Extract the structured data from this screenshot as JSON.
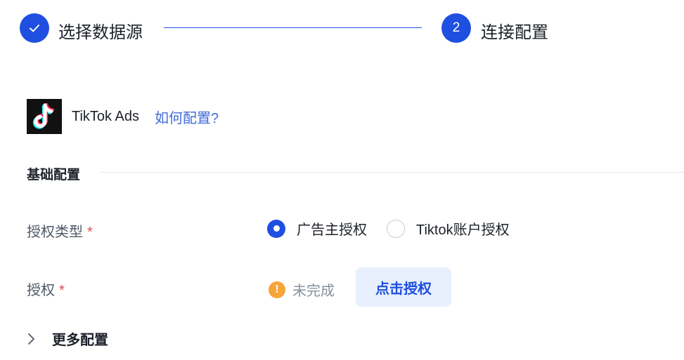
{
  "steps": [
    {
      "label": "选择数据源",
      "status": "done",
      "icon": "check-icon"
    },
    {
      "number": "2",
      "label": "连接配置",
      "status": "active"
    }
  ],
  "app": {
    "name": "TikTok Ads",
    "help_link": "如何配置?",
    "logo_icon": "tiktok-logo"
  },
  "section": {
    "title": "基础配置"
  },
  "form": {
    "auth_type": {
      "label": "授权类型",
      "required_mark": "*",
      "options": [
        {
          "label": "广告主授权",
          "selected": true
        },
        {
          "label": "Tiktok账户授权",
          "selected": false
        }
      ]
    },
    "auth": {
      "label": "授权",
      "required_mark": "*",
      "status_icon": "warning-icon",
      "status_icon_glyph": "!",
      "status_text": "未完成",
      "button_label": "点击授权"
    }
  },
  "more": {
    "label": "更多配置",
    "icon": "chevron-right-icon"
  },
  "colors": {
    "primary": "#1f4fe0",
    "link": "#3f6ad8",
    "warning": "#f7a43a",
    "required": "#e5484d",
    "button_bg": "#e8f0fd"
  }
}
